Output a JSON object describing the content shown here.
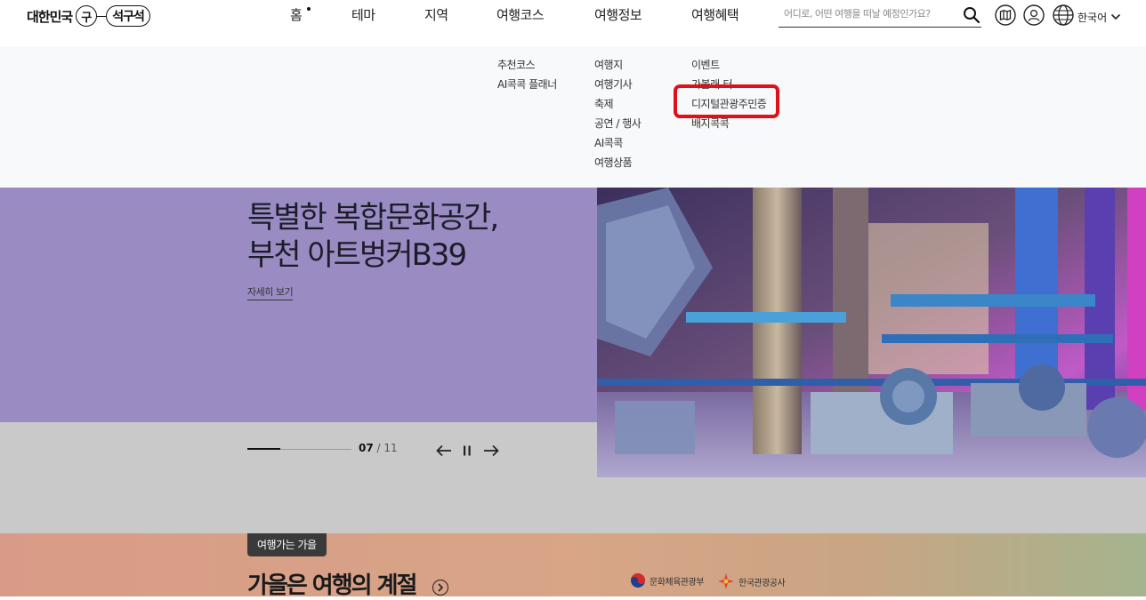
{
  "header": {
    "logo": {
      "prefix": "대한민국",
      "mark_char": "구",
      "mark_pill": "석구석"
    },
    "nav": [
      {
        "label": "홈",
        "active": true
      },
      {
        "label": "테마"
      },
      {
        "label": "지역"
      },
      {
        "label": "여행코스"
      },
      {
        "label": "여행정보"
      },
      {
        "label": "여행혜택"
      }
    ],
    "search": {
      "placeholder": "어디로, 어떤 여행을 떠날 예정인가요?"
    },
    "icons": [
      "search-icon",
      "map-icon",
      "user-icon",
      "globe-icon",
      "chevron-down-icon"
    ],
    "language": "한국어"
  },
  "dropdown": {
    "columns": [
      {
        "items": [
          "추천코스",
          "AI콕콕 플래너"
        ]
      },
      {
        "items": [
          "여행지",
          "여행기사",
          "축제",
          "공연 / 행사",
          "AI콕콕",
          "여행상품"
        ]
      },
      {
        "items": [
          "이벤트",
          "가볼래-터",
          "디지털관광주민증",
          "배지콕콕"
        ]
      }
    ],
    "highlighted_item": "디지털관광주민증",
    "highlight_color": "#e0101a"
  },
  "hero": {
    "title_line1": "특별한 복합문화공간,",
    "title_line2": "부천 아트벙커B39",
    "more_link": "자세히 보기",
    "slide_current": "07",
    "slide_separator": "/",
    "slide_total": "11",
    "progress_fraction": 0.32,
    "bg_color": "#9a8cc2"
  },
  "section": {
    "badge": "여행가는 가을",
    "title": "가을은 여행의 계절",
    "sponsors": [
      "문화체육관광부",
      "한국관광공사"
    ]
  }
}
